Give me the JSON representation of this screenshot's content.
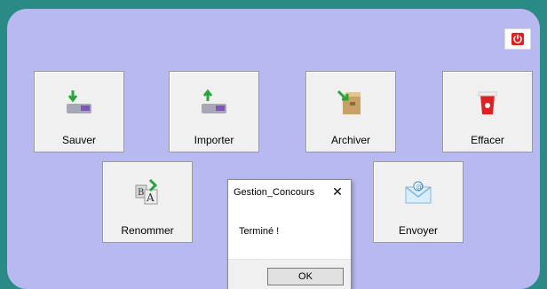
{
  "colors": {
    "background_teal": "#2a8a86",
    "window_lavender": "#b9b9f1",
    "tile_bg": "#f0f0f0",
    "accent_red": "#e02020",
    "accent_green": "#27ae3a"
  },
  "toolbar": {
    "power_icon": "power-icon",
    "row1": [
      {
        "label": "Sauver",
        "icon": "save-down-arrow-icon"
      },
      {
        "label": "Importer",
        "icon": "import-up-arrow-icon"
      },
      {
        "label": "Archiver",
        "icon": "archive-box-icon"
      },
      {
        "label": "Effacer",
        "icon": "trash-icon"
      }
    ],
    "row2": [
      {
        "label": "Renommer",
        "icon": "rename-ba-icon"
      },
      {
        "label": "Envoyer",
        "icon": "envelope-icon"
      }
    ]
  },
  "dialog": {
    "title": "Gestion_Concours",
    "message": "Terminé !",
    "ok_label": "OK",
    "close_glyph": "✕"
  }
}
